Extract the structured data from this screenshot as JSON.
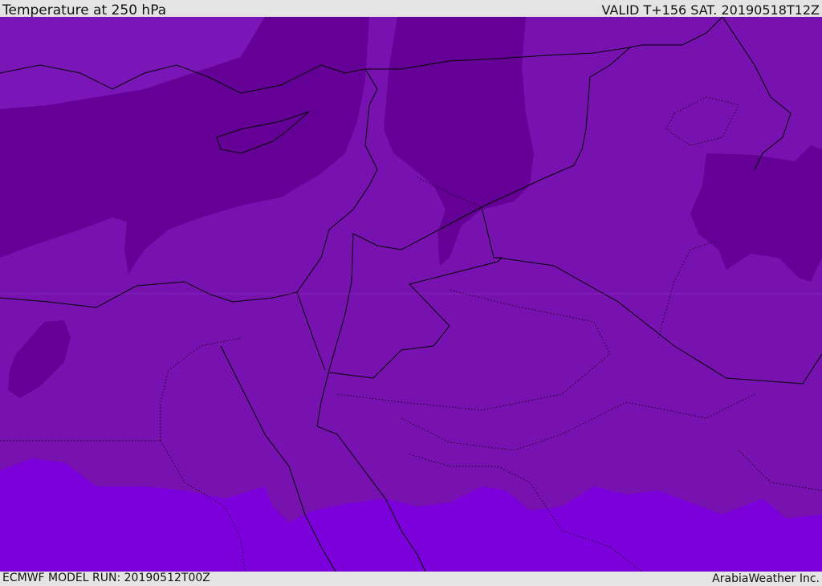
{
  "header": {
    "title": "Temperature at 250 hPa",
    "valid": "VALID T+156 SAT. 20190518T12Z"
  },
  "footer": {
    "model_run": "ECMWF MODEL RUN: 20190512T00Z",
    "credit": "ArabiaWeather Inc."
  },
  "colors": {
    "cold": "#650096",
    "mid": "#7712b0",
    "warm": "#7c00dc",
    "border": "#000000"
  }
}
